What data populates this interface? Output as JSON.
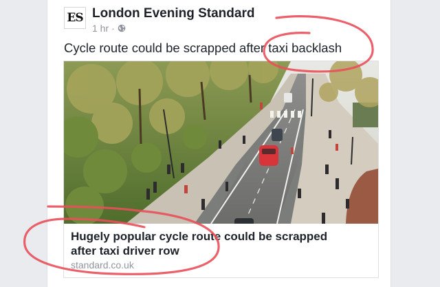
{
  "post": {
    "page_name": "London Evening Standard",
    "logo_text": "ES",
    "time": "1 hr",
    "separator": "·",
    "privacy_icon": "globe-icon",
    "text": "Cycle route could be scrapped after taxi backlash"
  },
  "link": {
    "title_line1": "Hugely popular cycle route could be scrapped",
    "title_line2": "after taxi driver row",
    "domain": "standard.co.uk",
    "image_description_icon": "street-scene-image"
  },
  "annotations": {
    "ink_color": "#e8505b"
  },
  "colors": {
    "page_bg": "#e9ebee",
    "card_bg": "#ffffff",
    "primary_text": "#1d2129",
    "secondary_text": "#90949c",
    "border": "#dddfe2"
  }
}
